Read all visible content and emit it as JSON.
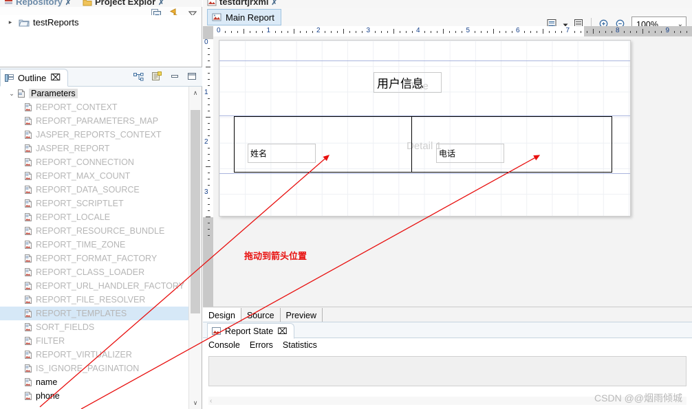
{
  "project_explorer": {
    "cut_tabs": [
      {
        "label": "Repository",
        "icon": "repository-icon"
      },
      {
        "label": "Project Explor",
        "icon": "project-folder-icon"
      }
    ],
    "toolbar": [
      {
        "name": "collapse-all-icon",
        "title": "Collapse All"
      },
      {
        "name": "link-with-editor-icon",
        "title": "Link with Editor"
      },
      {
        "name": "view-menu-icon",
        "title": "View Menu"
      }
    ],
    "tree": [
      {
        "label": "testReports",
        "icon": "folder-icon"
      }
    ]
  },
  "outline": {
    "tab_label": "Outline",
    "close_glyph": "⌧",
    "toolbar": [
      {
        "name": "tree-hierarchy-icon"
      },
      {
        "name": "properties-icon"
      },
      {
        "name": "minimize-icon"
      },
      {
        "name": "maximize-icon"
      }
    ],
    "root": {
      "label": "Parameters",
      "expanded": true,
      "caret": "⌄"
    },
    "items": [
      {
        "label": "REPORT_CONTEXT",
        "state": "dim"
      },
      {
        "label": "REPORT_PARAMETERS_MAP",
        "state": "dim"
      },
      {
        "label": "JASPER_REPORTS_CONTEXT",
        "state": "dim"
      },
      {
        "label": "JASPER_REPORT",
        "state": "dim"
      },
      {
        "label": "REPORT_CONNECTION",
        "state": "dim"
      },
      {
        "label": "REPORT_MAX_COUNT",
        "state": "dim"
      },
      {
        "label": "REPORT_DATA_SOURCE",
        "state": "dim"
      },
      {
        "label": "REPORT_SCRIPTLET",
        "state": "dim"
      },
      {
        "label": "REPORT_LOCALE",
        "state": "dim"
      },
      {
        "label": "REPORT_RESOURCE_BUNDLE",
        "state": "dim"
      },
      {
        "label": "REPORT_TIME_ZONE",
        "state": "dim"
      },
      {
        "label": "REPORT_FORMAT_FACTORY",
        "state": "dim"
      },
      {
        "label": "REPORT_CLASS_LOADER",
        "state": "dim"
      },
      {
        "label": "REPORT_URL_HANDLER_FACTORY",
        "state": "dim"
      },
      {
        "label": "REPORT_FILE_RESOLVER",
        "state": "dim"
      },
      {
        "label": "REPORT_TEMPLATES",
        "state": "selected"
      },
      {
        "label": "SORT_FIELDS",
        "state": "dim"
      },
      {
        "label": "FILTER",
        "state": "dim"
      },
      {
        "label": "REPORT_VIRTUALIZER",
        "state": "dim"
      },
      {
        "label": "IS_IGNORE_PAGINATION",
        "state": "dim"
      },
      {
        "label": "name",
        "state": "solid"
      },
      {
        "label": "phone",
        "state": "solid"
      }
    ],
    "scrollbar": {
      "up_glyph": "∧",
      "down_glyph": "∨"
    }
  },
  "editor": {
    "cut_tabs": [
      {
        "label": "testdrtjrxml",
        "icon": "jrxml-file-icon"
      }
    ],
    "active_tab": {
      "label": "Main Report",
      "icon": "report-icon"
    },
    "toolbar": [
      {
        "name": "dataset-icon"
      },
      {
        "name": "chevron-down-icon"
      },
      {
        "name": "bands-icon"
      },
      {
        "name": "zoom-in-icon"
      },
      {
        "name": "zoom-out-icon"
      }
    ],
    "zoom": {
      "value": "100%",
      "chevron": "⌄"
    },
    "ruler": {
      "h_labels": [
        "0",
        "1",
        "2",
        "3",
        "4",
        "5",
        "6",
        "7",
        "8",
        "9"
      ],
      "v_labels": [
        "0",
        "1",
        "2",
        "3"
      ]
    },
    "canvas": {
      "bands": [
        {
          "name": "Title",
          "label": "Title"
        },
        {
          "name": "Detail 1",
          "label": "Detail 1"
        }
      ],
      "elements": [
        {
          "name": "title-text-field",
          "text": "用户信息"
        },
        {
          "name": "name-text-field",
          "text": "姓名"
        },
        {
          "name": "phone-text-field",
          "text": "电话"
        }
      ]
    },
    "mode_tabs": [
      {
        "label": "Design",
        "active": true
      },
      {
        "label": "Source",
        "active": false
      },
      {
        "label": "Preview",
        "active": false
      }
    ]
  },
  "report_state": {
    "tab_label": "Report State",
    "close_glyph": "⌧",
    "sub_tabs": [
      "Console",
      "Errors",
      "Statistics"
    ],
    "console_text": "",
    "scroll_arrow": "‹"
  },
  "annotations": {
    "note": "拖动到箭头位置",
    "color": "#e8100f"
  },
  "watermark": "CSDN @@烟雨倾城",
  "colors": {
    "accent": "#dbeaf7",
    "selection": "#d6e8f7",
    "annotation": "#e8100f",
    "ruler_number": "#16418a",
    "band_label": "#cfcfcf"
  }
}
